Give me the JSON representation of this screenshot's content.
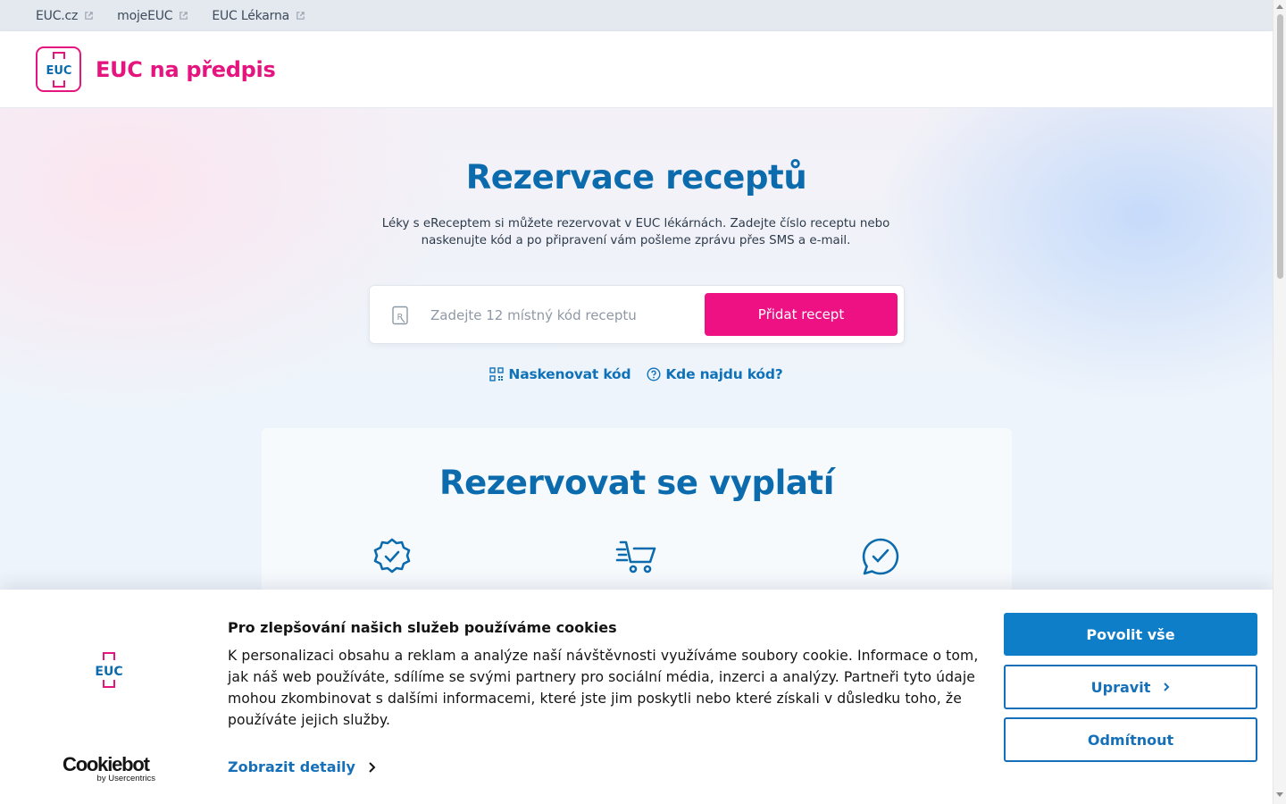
{
  "topbar": {
    "links": [
      {
        "label": "EUC.cz"
      },
      {
        "label": "mojeEUC"
      },
      {
        "label": "EUC Lékarna"
      }
    ]
  },
  "header": {
    "brand": "EUC na předpis",
    "logo_text": "EUC"
  },
  "hero": {
    "title": "Rezervace receptů",
    "subtitle_line1": "Léky s eReceptem si můžete rezervovat v EUC lékárnách. Zadejte číslo receptu nebo",
    "subtitle_line2": "naskenujte kód a po připravení vám pošleme zprávu přes SMS a e-mail.",
    "search": {
      "placeholder": "Zadejte 12 místný kód receptu",
      "value": "",
      "button": "Přidat recept"
    },
    "scan_link": "Naskenovat kód",
    "help_link": "Kde najdu kód?"
  },
  "benefits": {
    "title": "Rezervovat se vyplatí",
    "icons": [
      "badge-check-icon",
      "fast-cart-icon",
      "chat-check-icon"
    ]
  },
  "cookie_banner": {
    "title": "Pro zlepšování našich služeb používáme cookies",
    "text": "K personalizaci obsahu a reklam a analýze naší návštěvnosti využíváme soubory cookie. Informace o tom, jak náš web používáte, sdílíme se svými partnery pro sociální média, inzerci a analýzy. Partneři tyto údaje mohou zkombinovat s dalšími informacemi, které jste jim poskytli nebo které získali v důsledku toho, že používáte jejich služby.",
    "details_link": "Zobrazit detaily",
    "allow_all": "Povolit vše",
    "customize": "Upravit",
    "deny": "Odmítnout",
    "provider_name": "Cookiebot",
    "provider_sub": "by Usercentrics",
    "logo_text": "EUC"
  },
  "colors": {
    "brand_pink": "#e5157f",
    "primary_blue": "#0b6bad",
    "cookie_blue": "#0f7ec8"
  }
}
